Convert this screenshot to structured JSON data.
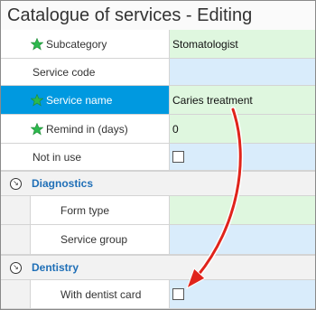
{
  "window": {
    "title": "Catalogue of services - Editing"
  },
  "fields": {
    "subcategory": {
      "label": "Subcategory",
      "value": "Stomatologist"
    },
    "service_code": {
      "label": "Service code",
      "value": ""
    },
    "service_name": {
      "label": "Service name",
      "value": "Caries treatment"
    },
    "remind_in": {
      "label": "Remind in (days)",
      "value": "0"
    },
    "not_in_use": {
      "label": "Not in use",
      "checked": false
    }
  },
  "groups": {
    "diagnostics": {
      "label": "Diagnostics",
      "form_type": {
        "label": "Form type",
        "value": ""
      },
      "service_group": {
        "label": "Service group",
        "value": ""
      }
    },
    "dentistry": {
      "label": "Dentistry",
      "with_dentist_card": {
        "label": "With dentist card",
        "checked": false
      }
    }
  },
  "colors": {
    "required_star": "#2db84d",
    "selected_row": "#0099e0",
    "group_label": "#1f6fb7",
    "arrow": "#e0241b",
    "value_green": "#dff7df",
    "value_blue": "#d9ecfb"
  },
  "icons": {
    "required": "green-star-icon",
    "group_toggle": "collapse-circle-icon"
  }
}
